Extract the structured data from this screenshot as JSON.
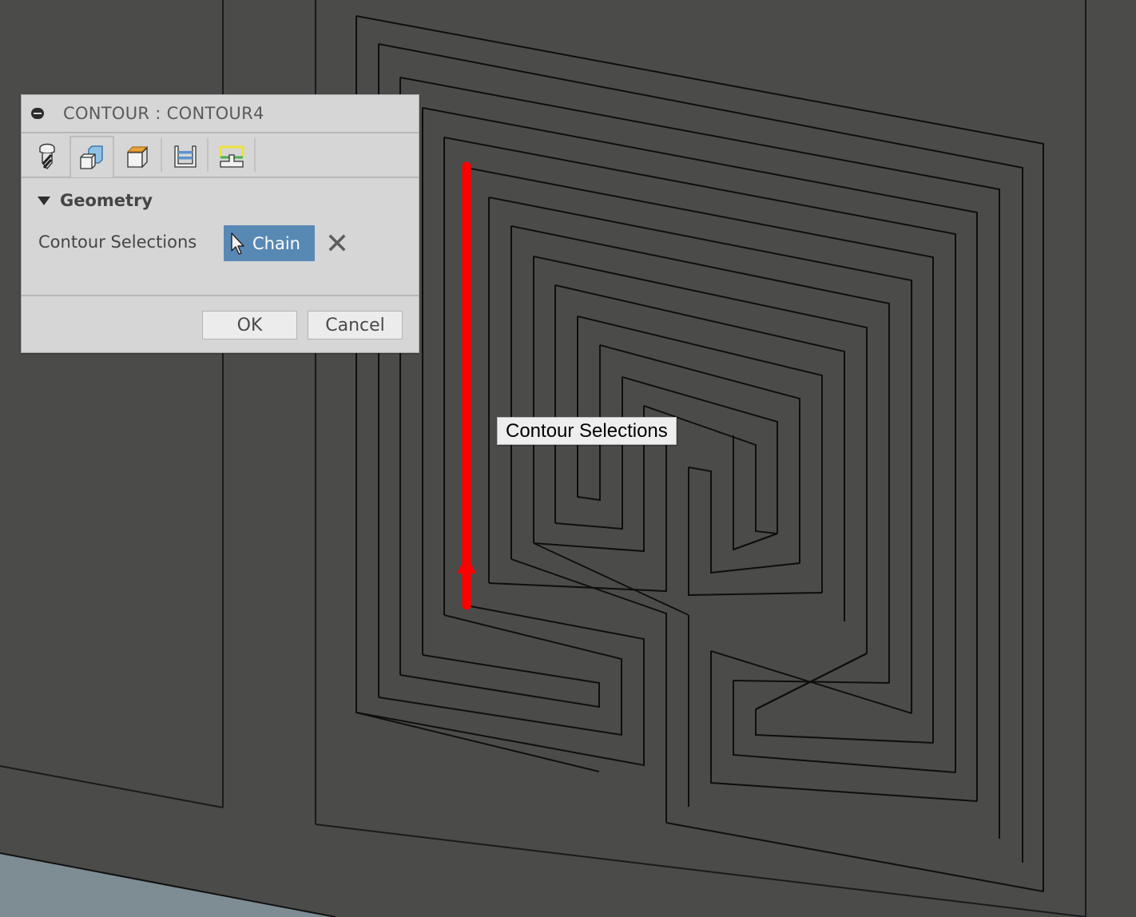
{
  "dialog": {
    "title": "CONTOUR : CONTOUR4",
    "tabs": [
      {
        "name": "tool",
        "icon": "drill-bit-icon",
        "active": false
      },
      {
        "name": "geometry",
        "icon": "geometry-block-icon",
        "active": true
      },
      {
        "name": "heights",
        "icon": "heights-box-icon",
        "active": false
      },
      {
        "name": "passes",
        "icon": "passes-icon",
        "active": false
      },
      {
        "name": "linking",
        "icon": "linking-icon",
        "active": false
      }
    ],
    "section": {
      "title": "Geometry",
      "expanded": true
    },
    "contour_selections": {
      "label": "Contour Selections",
      "button_label": "Chain",
      "clear_icon": "close-icon"
    },
    "buttons": {
      "ok": "OK",
      "cancel": "Cancel"
    }
  },
  "tooltip": {
    "text": "Contour Selections"
  },
  "colors": {
    "viewport_bg": "#4b4b4a",
    "floor": "#7e8c94",
    "selection": "#ff0000",
    "chain_button": "#5889b5",
    "dialog_bg": "#d6d6d6"
  }
}
